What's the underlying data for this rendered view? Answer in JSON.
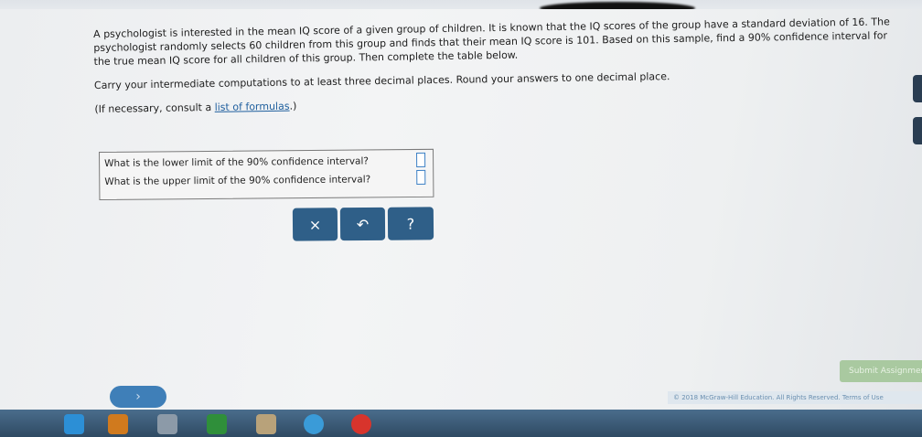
{
  "question": {
    "paragraph1": "A psychologist is interested in the mean IQ score of a given group of children. It is known that the IQ scores of the group have a standard deviation of 16. The psychologist randomly selects 60 children from this group and finds that their mean IQ score is 101. Based on this sample, find a 90% confidence interval for the true mean IQ score for all children of this group. Then complete the table below.",
    "paragraph2": "Carry your intermediate computations to at least three decimal places. Round your answers to one decimal place.",
    "formulas_prefix": "(If necessary, consult a ",
    "formulas_link": "list of formulas",
    "formulas_suffix": ".)"
  },
  "table": {
    "rows": [
      {
        "label": "What is the lower limit of the 90% confidence interval?",
        "value": ""
      },
      {
        "label": "What is the upper limit of the 90% confidence interval?",
        "value": ""
      }
    ]
  },
  "toolbar": {
    "clear_label": "×",
    "undo_label": "↶",
    "help_label": "?"
  },
  "submit_label": "Submit Assignment",
  "footer_text": "© 2018 McGraw-Hill Education. All Rights Reserved.   Terms of Use",
  "colors": {
    "button": "#2f5f88",
    "link": "#1f5f9e",
    "input_border": "#3b7fc4"
  },
  "icons": [
    "next-arrow-icon",
    "taskbar-app-icon"
  ]
}
